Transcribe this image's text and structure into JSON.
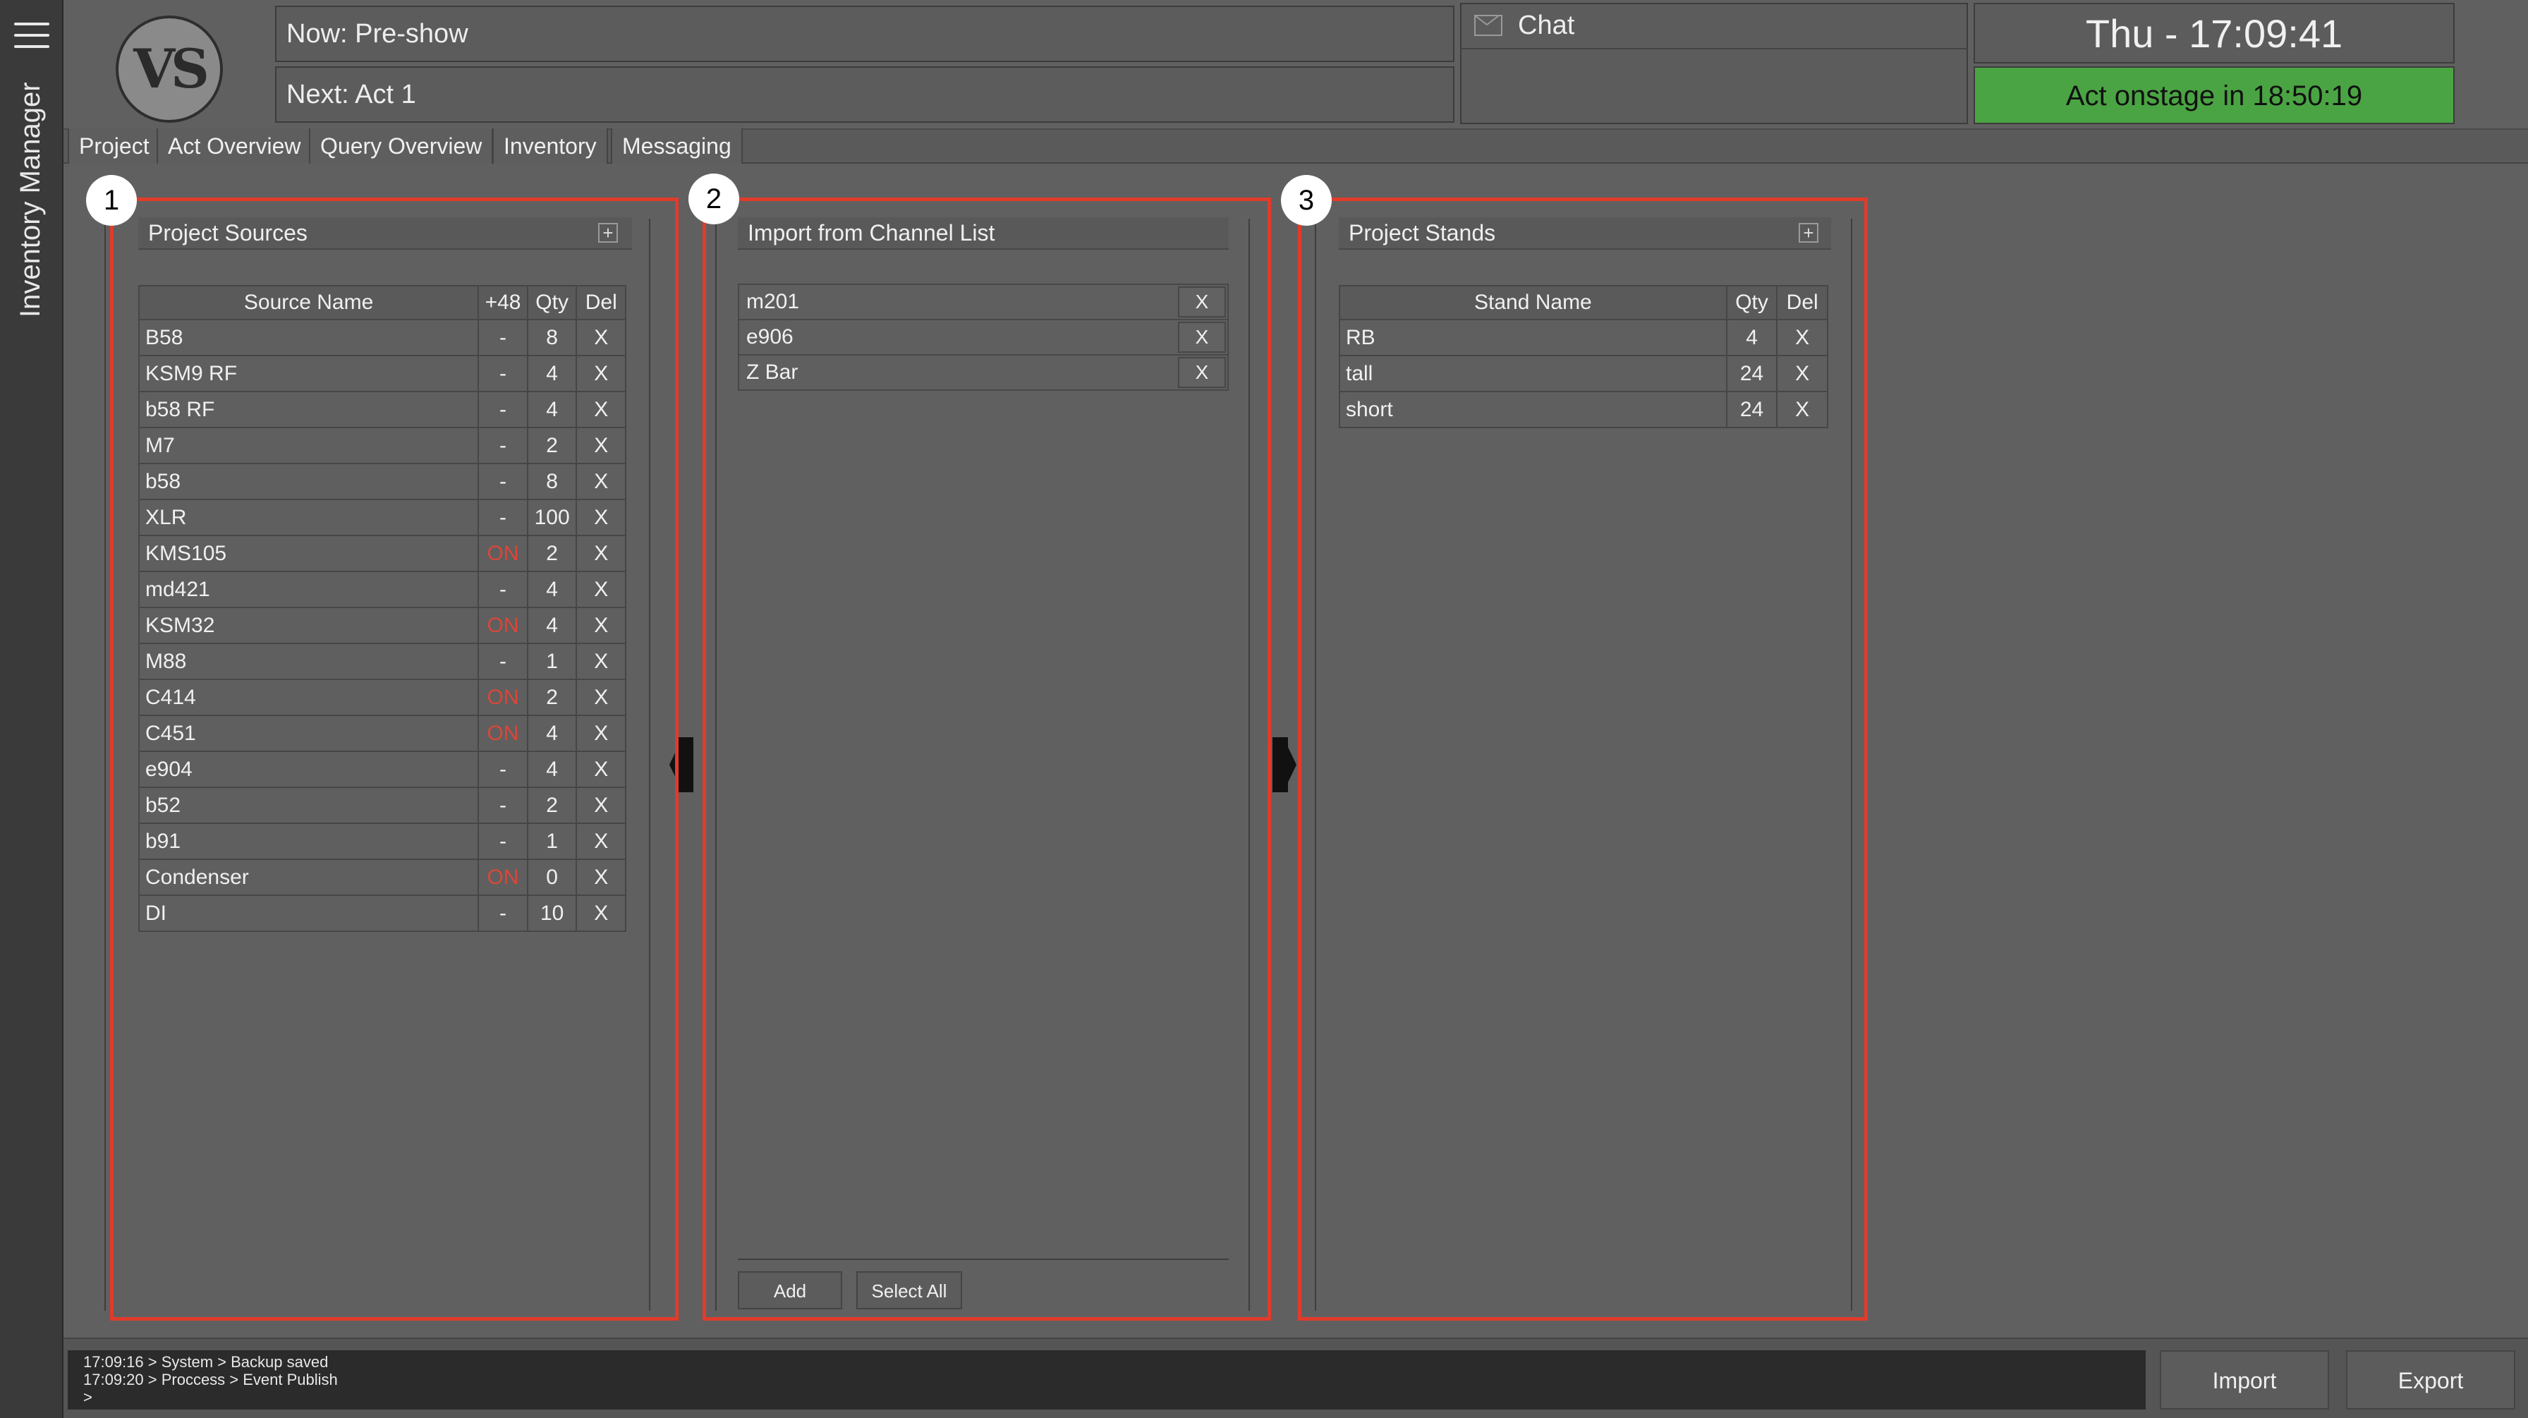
{
  "sidebar": {
    "title": "Inventory Manager"
  },
  "header": {
    "logo_text": "VS",
    "now": "Now: Pre-show",
    "next": "Next: Act 1",
    "chat_label": "Chat",
    "clock": "Thu - 17:09:41",
    "onstage": "Act onstage in 18:50:19"
  },
  "tabs": [
    "Project",
    "Act Overview",
    "Query Overview",
    "Inventory",
    "Messaging"
  ],
  "badges": [
    "1",
    "2",
    "3"
  ],
  "sources": {
    "title": "Project Sources",
    "add_symbol": "+",
    "columns": [
      "Source Name",
      "+48",
      "Qty",
      "Del"
    ],
    "rows": [
      {
        "name": "B58",
        "phantom": "-",
        "qty": "8",
        "del": "X"
      },
      {
        "name": "KSM9 RF",
        "phantom": "-",
        "qty": "4",
        "del": "X"
      },
      {
        "name": "b58 RF",
        "phantom": "-",
        "qty": "4",
        "del": "X"
      },
      {
        "name": "M7",
        "phantom": "-",
        "qty": "2",
        "del": "X"
      },
      {
        "name": "b58",
        "phantom": "-",
        "qty": "8",
        "del": "X"
      },
      {
        "name": "XLR",
        "phantom": "-",
        "qty": "100",
        "del": "X"
      },
      {
        "name": "KMS105",
        "phantom": "ON",
        "qty": "2",
        "del": "X"
      },
      {
        "name": "md421",
        "phantom": "-",
        "qty": "4",
        "del": "X"
      },
      {
        "name": "KSM32",
        "phantom": "ON",
        "qty": "4",
        "del": "X"
      },
      {
        "name": "M88",
        "phantom": "-",
        "qty": "1",
        "del": "X"
      },
      {
        "name": "C414",
        "phantom": "ON",
        "qty": "2",
        "del": "X"
      },
      {
        "name": "C451",
        "phantom": "ON",
        "qty": "4",
        "del": "X"
      },
      {
        "name": "e904",
        "phantom": "-",
        "qty": "4",
        "del": "X"
      },
      {
        "name": "b52",
        "phantom": "-",
        "qty": "2",
        "del": "X"
      },
      {
        "name": "b91",
        "phantom": "-",
        "qty": "1",
        "del": "X"
      },
      {
        "name": "Condenser",
        "phantom": "ON",
        "qty": "0",
        "del": "X"
      },
      {
        "name": "DI",
        "phantom": "-",
        "qty": "10",
        "del": "X"
      }
    ]
  },
  "channel_import": {
    "title": "Import from Channel List",
    "items": [
      {
        "name": "m201",
        "del": "X"
      },
      {
        "name": "e906",
        "del": "X"
      },
      {
        "name": "Z Bar",
        "del": "X"
      }
    ],
    "add_label": "Add",
    "select_all_label": "Select All"
  },
  "stands": {
    "title": "Project Stands",
    "add_symbol": "+",
    "columns": [
      "Stand Name",
      "Qty",
      "Del"
    ],
    "rows": [
      {
        "name": "RB",
        "qty": "4",
        "del": "X"
      },
      {
        "name": "tall",
        "qty": "24",
        "del": "X"
      },
      {
        "name": "short",
        "qty": "24",
        "del": "X"
      }
    ]
  },
  "log": {
    "lines": [
      "17:09:16 > System > Backup saved",
      "17:09:20 > Proccess > Event Publish",
      ">"
    ]
  },
  "footer": {
    "import_label": "Import",
    "export_label": "Export"
  },
  "colors": {
    "accent_red": "#e23b2a",
    "onstage_green": "#4aa443",
    "phantom_on": "#d9473a"
  }
}
